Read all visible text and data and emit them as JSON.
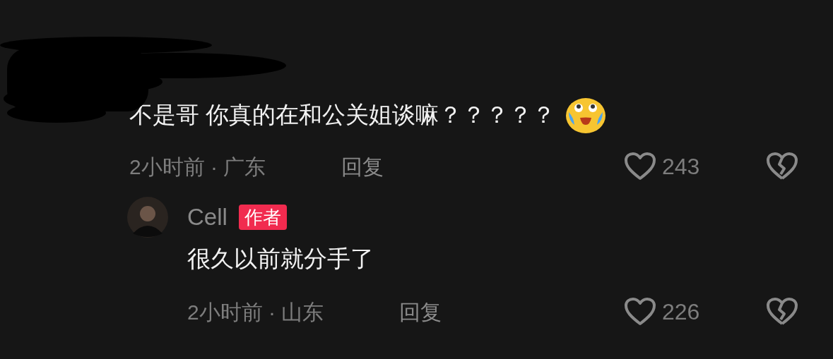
{
  "comment": {
    "text": "不是哥 你真的在和公关姐谈嘛？？？？？",
    "meta": "2小时前 · 广东",
    "reply_label": "回复",
    "like_count": "243",
    "replies": [
      {
        "author": "Cell",
        "badge": "作者",
        "text": "很久以前就分手了",
        "meta": "2小时前 · 山东",
        "reply_label": "回复",
        "like_count": "226"
      }
    ]
  }
}
